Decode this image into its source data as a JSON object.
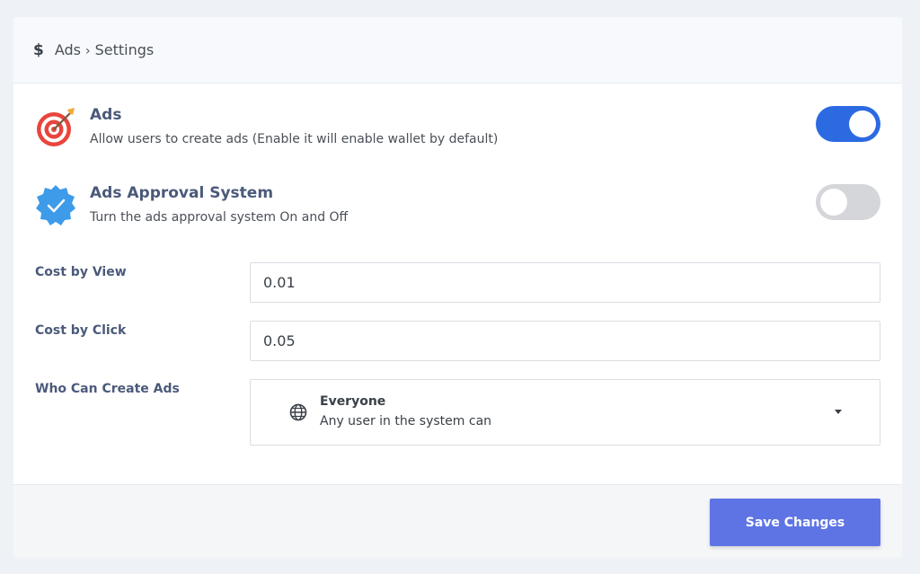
{
  "breadcrumb": {
    "icon": "dollar-icon",
    "icon_glyph": "$",
    "section": "Ads",
    "separator": "›",
    "page": "Settings"
  },
  "settings": [
    {
      "icon": "target-icon",
      "title": "Ads",
      "description": "Allow users to create ads (Enable it will enable wallet by default)",
      "enabled": true
    },
    {
      "icon": "verified-badge-icon",
      "title": "Ads Approval System",
      "description": "Turn the ads approval system On and Off",
      "enabled": false
    }
  ],
  "fields": {
    "cost_by_view": {
      "label": "Cost by View",
      "value": "0.01"
    },
    "cost_by_click": {
      "label": "Cost by Click",
      "value": "0.05"
    },
    "who_can_create": {
      "label": "Who Can Create Ads",
      "selected_icon": "globe-icon",
      "selected_title": "Everyone",
      "selected_description": "Any user in the system can"
    }
  },
  "footer": {
    "save_label": "Save Changes"
  },
  "colors": {
    "accent": "#2c6ae2",
    "save_button": "#5e74e5",
    "toggle_off": "#d4d6da",
    "label": "#4b5a7a",
    "target_red": "#e8453c",
    "badge_blue": "#3d9be9"
  }
}
